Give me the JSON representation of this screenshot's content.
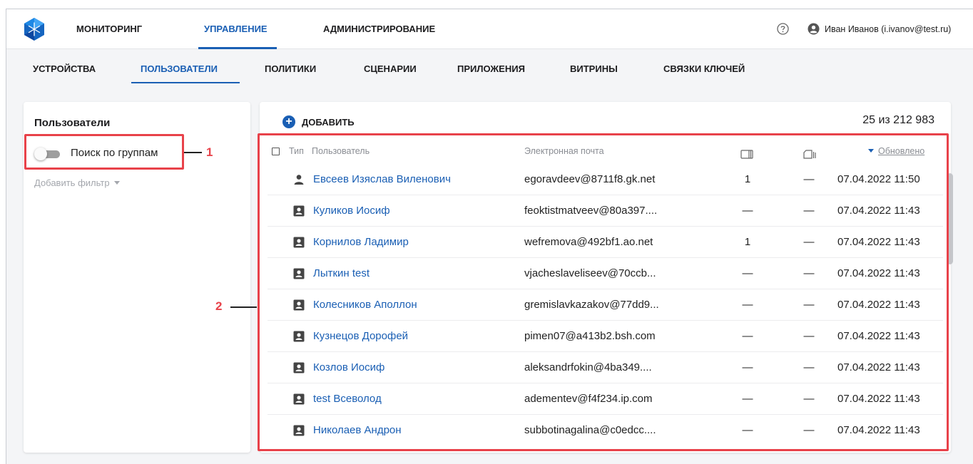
{
  "header": {
    "nav": [
      {
        "label": "МОНИТОРИНГ",
        "active": false
      },
      {
        "label": "УПРАВЛЕНИЕ",
        "active": true
      },
      {
        "label": "АДМИНИСТРИРОВАНИЕ",
        "active": false
      }
    ],
    "user": "Иван Иванов (i.ivanov@test.ru)",
    "icons": [
      "logo",
      "help-icon",
      "user-icon"
    ]
  },
  "subnav": [
    {
      "label": "УСТРОЙСТВА",
      "active": false
    },
    {
      "label": "ПОЛЬЗОВАТЕЛИ",
      "active": true
    },
    {
      "label": "ПОЛИТИКИ",
      "active": false
    },
    {
      "label": "СЦЕНАРИИ",
      "active": false
    },
    {
      "label": "ПРИЛОЖЕНИЯ",
      "active": false
    },
    {
      "label": "ВИТРИНЫ",
      "active": false
    },
    {
      "label": "СВЯЗКИ КЛЮЧЕЙ",
      "active": false
    }
  ],
  "left_panel": {
    "title": "Пользователи",
    "toggle_label": "Поиск по группам",
    "toggle_on": false,
    "add_filter": "Добавить фильтр"
  },
  "main": {
    "add_label": "ДОБАВИТЬ",
    "count": "25 из 212 983",
    "columns": {
      "type": "Тип",
      "user": "Пользователь",
      "email": "Электронная почта",
      "sort": "Обновлено"
    },
    "rows": [
      {
        "type": "person",
        "name": "Евсеев Изяслав Виленович",
        "email": "egoravdeev@8711f8.gk.net",
        "c1": "1",
        "c2": "—",
        "updated": "07.04.2022 11:50"
      },
      {
        "type": "contact",
        "name": "Куликов Иосиф",
        "email": "feoktistmatveev@80a397....",
        "c1": "—",
        "c2": "—",
        "updated": "07.04.2022 11:43"
      },
      {
        "type": "contact",
        "name": "Корнилов Ладимир",
        "email": "wefremova@492bf1.ao.net",
        "c1": "1",
        "c2": "—",
        "updated": "07.04.2022 11:43"
      },
      {
        "type": "contact",
        "name": "Лыткин test",
        "email": "vjacheslaveliseev@70ccb...",
        "c1": "—",
        "c2": "—",
        "updated": "07.04.2022 11:43"
      },
      {
        "type": "contact",
        "name": "Колесников Аполлон",
        "email": "gremislavkazakov@77dd9...",
        "c1": "—",
        "c2": "—",
        "updated": "07.04.2022 11:43"
      },
      {
        "type": "contact",
        "name": "Кузнецов Дорофей",
        "email": "pimen07@a413b2.bsh.com",
        "c1": "—",
        "c2": "—",
        "updated": "07.04.2022 11:43"
      },
      {
        "type": "contact",
        "name": "Козлов Иосиф",
        "email": "aleksandrfokin@4ba349....",
        "c1": "—",
        "c2": "—",
        "updated": "07.04.2022 11:43"
      },
      {
        "type": "contact",
        "name": "test Всеволод",
        "email": "adementev@f4f234.ip.com",
        "c1": "—",
        "c2": "—",
        "updated": "07.04.2022 11:43"
      },
      {
        "type": "contact",
        "name": "Николаев Андрон",
        "email": "subbotinagalina@c0edcc....",
        "c1": "—",
        "c2": "—",
        "updated": "07.04.2022 11:43"
      }
    ]
  },
  "annotations": [
    "1",
    "2"
  ],
  "colors": {
    "accent": "#1a5fb4",
    "annotation": "#e8424a"
  }
}
